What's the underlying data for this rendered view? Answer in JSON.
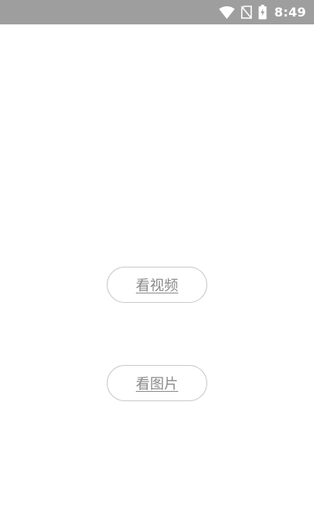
{
  "status_bar": {
    "time": "8:49",
    "icons": [
      "wifi-icon",
      "no-sim-icon",
      "battery-charging-icon"
    ],
    "background": "#9e9e9e"
  },
  "main": {
    "buttons": [
      {
        "label": "看视频"
      },
      {
        "label": "看图片"
      }
    ],
    "button_text_color": "#8a8a8a",
    "button_border_color": "#c9c9c9"
  }
}
